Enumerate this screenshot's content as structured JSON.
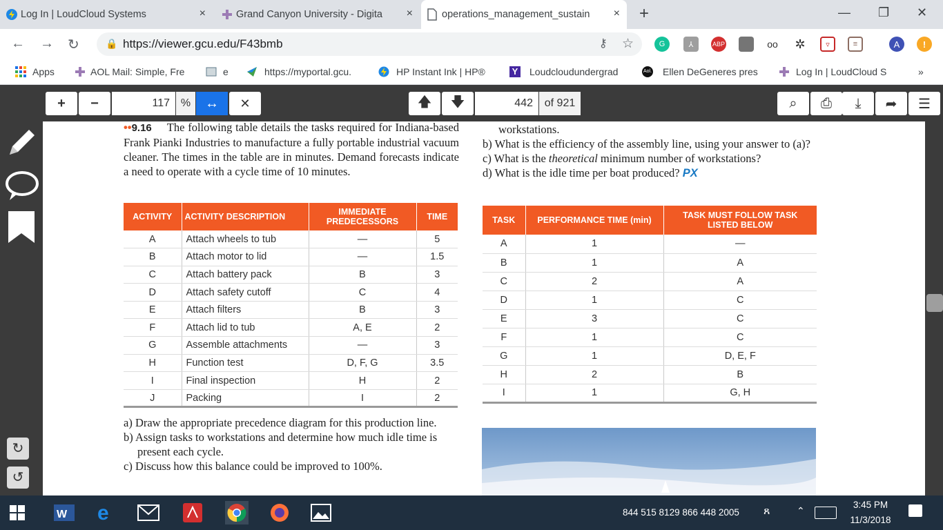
{
  "tabs": [
    {
      "label": "Log In | LoudCloud Systems",
      "close": "×"
    },
    {
      "label": "Grand Canyon University - Digita",
      "close": "×"
    },
    {
      "label": "operations_management_sustain",
      "close": "×"
    }
  ],
  "new_tab": "+",
  "window_controls": {
    "minimize": "—",
    "restore": "❐",
    "close": "✕"
  },
  "address": {
    "url": "https://viewer.gcu.edu/F43bmb"
  },
  "bookmarks": [
    {
      "label": "Apps"
    },
    {
      "label": "AOL Mail: Simple, Fre"
    },
    {
      "label": "e"
    },
    {
      "label": "https://myportal.gcu."
    },
    {
      "label": "HP Instant Ink | HP®"
    },
    {
      "label": "Loudcloudundergrad"
    },
    {
      "label": "Ellen DeGeneres pres"
    },
    {
      "label": "Log In | LoudCloud S"
    }
  ],
  "bookmarks_more": "»",
  "viewer": {
    "zoom_in": "+",
    "zoom_out": "−",
    "zoom": "117",
    "zoom_unit": "%",
    "page": "442",
    "page_total": "of 921"
  },
  "problem": {
    "number": "9.16",
    "bullets": "••",
    "intro": "The following table details the tasks required for Indiana-based Frank Pianki Industries to manufacture a fully portable industrial vacuum cleaner. The times in the table are in minutes. Demand forecasts indicate a need to operate with a cycle time of 10 minutes.",
    "headers": [
      "ACTIVITY",
      "ACTIVITY DESCRIPTION",
      "IMMEDIATE PREDECESSORS",
      "TIME"
    ],
    "rows": [
      [
        "A",
        "Attach wheels to tub",
        "—",
        "5"
      ],
      [
        "B",
        "Attach motor to lid",
        "—",
        "1.5"
      ],
      [
        "C",
        "Attach battery pack",
        "B",
        "3"
      ],
      [
        "D",
        "Attach safety cutoff",
        "C",
        "4"
      ],
      [
        "E",
        "Attach filters",
        "B",
        "3"
      ],
      [
        "F",
        "Attach lid to tub",
        "A, E",
        "2"
      ],
      [
        "G",
        "Assemble attachments",
        "—",
        "3"
      ],
      [
        "H",
        "Function test",
        "D, F, G",
        "3.5"
      ],
      [
        "I",
        "Final inspection",
        "H",
        "2"
      ],
      [
        "J",
        "Packing",
        "I",
        "2"
      ]
    ],
    "questions": [
      "a) Draw the appropriate precedence diagram for this production line.",
      "b) Assign tasks to workstations and determine how much idle time is present each cycle.",
      "c) Discuss how this balance could be improved to 100%."
    ]
  },
  "right_column": {
    "continued": "workstations.",
    "questions": [
      "b) What is the efficiency of the assembly line, using your answer to (a)?",
      "c) What is the theoretical minimum number of workstations?",
      "d) What is the idle time per boat produced?"
    ],
    "px_badge": "PX",
    "headers": [
      "TASK",
      "PERFORMANCE TIME (min)",
      "TASK MUST FOLLOW TASK LISTED BELOW"
    ],
    "rows": [
      [
        "A",
        "1",
        "—"
      ],
      [
        "B",
        "1",
        "A"
      ],
      [
        "C",
        "2",
        "A"
      ],
      [
        "D",
        "1",
        "C"
      ],
      [
        "E",
        "3",
        "C"
      ],
      [
        "F",
        "1",
        "C"
      ],
      [
        "G",
        "1",
        "D, E, F"
      ],
      [
        "H",
        "2",
        "B"
      ],
      [
        "I",
        "1",
        "G, H"
      ]
    ]
  },
  "taskbar": {
    "tray_text": "844 515 8129 866 448 2005",
    "time": "3:45 PM",
    "date": "11/3/2018"
  }
}
